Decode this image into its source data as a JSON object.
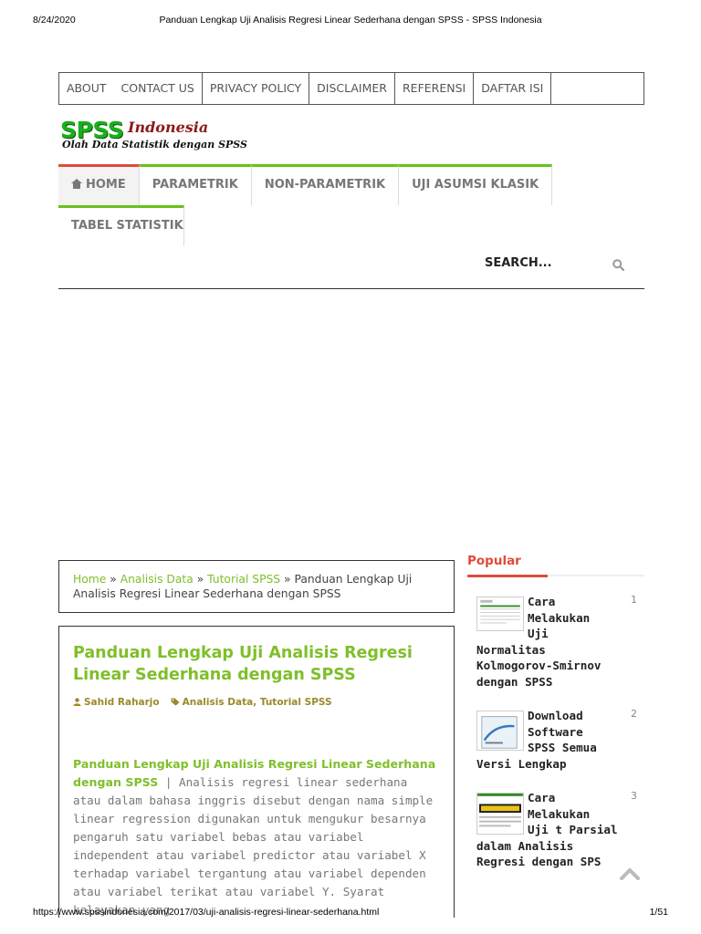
{
  "print": {
    "date": "8/24/2020",
    "title": "Panduan Lengkap Uji Analisis Regresi Linear Sederhana dengan SPSS - SPSS Indonesia",
    "url": "https://www.spssindonesia.com/2017/03/uji-analisis-regresi-linear-sederhana.html",
    "page": "1/51"
  },
  "topnav": [
    "About",
    "Contact Us",
    "Privacy Policy",
    "Disclaimer",
    "Referensi",
    "Daftar Isi"
  ],
  "logo": {
    "main": "SPSS",
    "sub": "Indonesia",
    "tagline": "Olah Data Statistik dengan SPSS"
  },
  "mainnav": [
    "Home",
    "Parametrik",
    "Non-Parametrik",
    "Uji Asumsi Klasik",
    "Tabel Statistik"
  ],
  "search": {
    "label": "Search..."
  },
  "breadcrumb": {
    "home": "Home",
    "sep": "»",
    "cat1": "Analisis Data",
    "cat2": "Tutorial SPSS",
    "current": "Panduan Lengkap Uji Analisis Regresi Linear Sederhana dengan SPSS"
  },
  "post": {
    "title": "Panduan Lengkap Uji Analisis Regresi Linear Sederhana dengan SPSS",
    "author": "Sahid Raharjo",
    "categories": "Analisis Data, Tutorial SPSS",
    "lead": "Panduan Lengkap Uji Analisis Regresi Linear Sederhana dengan SPSS",
    "body": " | Analisis regresi linear sederhana atau dalam bahasa inggris disebut dengan nama simple linear regression digunakan untuk mengukur besarnya pengaruh satu variabel bebas atau variabel independent atau variabel predictor atau variabel X terhadap variabel tergantung atau variabel dependen atau variabel terikat atau variabel Y. Syarat kelayakan yang"
  },
  "sidebar": {
    "title": "Popular",
    "items": [
      {
        "rank": "1",
        "l1": "Cara",
        "l2": "Melakukan",
        "l3": "Uji",
        "rest": [
          "Normalitas",
          "Kolmogorov-Smirnov",
          "dengan SPSS"
        ]
      },
      {
        "rank": "2",
        "l1": "Download",
        "l2": "Software",
        "l3": "SPSS Semua",
        "rest": [
          "Versi Lengkap"
        ]
      },
      {
        "rank": "3",
        "l1": "Cara",
        "l2": "Melakukan",
        "l3": "Uji t Parsial",
        "rest": [
          "dalam Analisis",
          "Regresi dengan SPS"
        ]
      }
    ]
  },
  "colors": {
    "accent_green": "#7fbf2a",
    "accent_red": "#e04a3a",
    "nav_green": "#6ac11a"
  },
  "icons": {
    "search": "search-icon",
    "home": "home-icon",
    "back_to_top": "chevron-up-icon",
    "author": "user-icon",
    "tags": "tag-icon"
  }
}
